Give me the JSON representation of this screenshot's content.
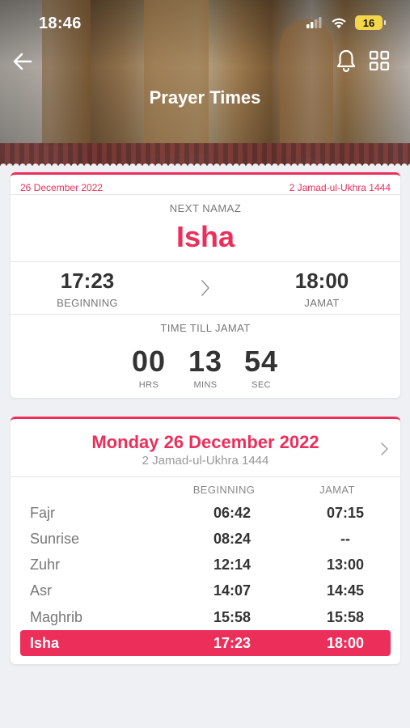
{
  "status_bar": {
    "time": "18:46",
    "battery": "16"
  },
  "header": {
    "title": "Prayer Times"
  },
  "next_namaz": {
    "gregorian_date": "26 December 2022",
    "hijri_date": "2 Jamad-ul-Ukhra 1444",
    "label": "NEXT NAMAZ",
    "name": "Isha",
    "beginning_time": "17:23",
    "beginning_label": "BEGINNING",
    "jamat_time": "18:00",
    "jamat_label": "JAMAT",
    "countdown_label": "TIME TILL JAMAT",
    "countdown": [
      {
        "value": "00",
        "unit": "HRS"
      },
      {
        "value": "13",
        "unit": "MINS"
      },
      {
        "value": "54",
        "unit": "SEC"
      }
    ]
  },
  "schedule": {
    "day_title": "Monday 26 December 2022",
    "hijri": "2 Jamad-ul-Ukhra 1444",
    "col_beginning": "BEGINNING",
    "col_jamat": "JAMAT",
    "rows": [
      {
        "name": "Fajr",
        "beginning": "06:42",
        "jamat": "07:15"
      },
      {
        "name": "Sunrise",
        "beginning": "08:24",
        "jamat": "--"
      },
      {
        "name": "Zuhr",
        "beginning": "12:14",
        "jamat": "13:00"
      },
      {
        "name": "Asr",
        "beginning": "14:07",
        "jamat": "14:45"
      },
      {
        "name": "Maghrib",
        "beginning": "15:58",
        "jamat": "15:58"
      },
      {
        "name": "Isha",
        "beginning": "17:23",
        "jamat": "18:00"
      }
    ],
    "active_row": "Isha"
  },
  "colors": {
    "accent": "#ec2f5a",
    "background": "#eef0f3"
  },
  "icons": [
    "back-arrow-icon",
    "bell-icon",
    "grid-icon",
    "chevron-right-icon",
    "wifi-icon",
    "signal-icon",
    "battery-icon"
  ]
}
